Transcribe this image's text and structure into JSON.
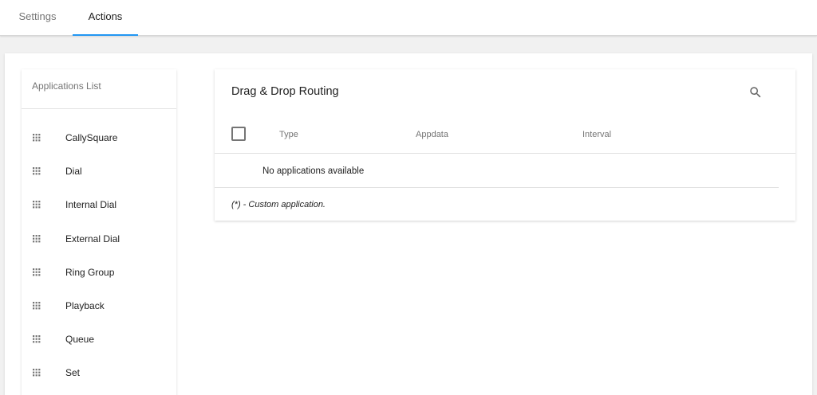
{
  "tabs": {
    "settings": "Settings",
    "actions": "Actions",
    "active": "Actions",
    "accent_color": "#2196f3"
  },
  "applications_list": {
    "title": "Applications List",
    "items": [
      {
        "label": "CallySquare",
        "icon": "drag-handle-icon"
      },
      {
        "label": "Dial",
        "icon": "drag-handle-icon"
      },
      {
        "label": "Internal Dial",
        "icon": "drag-handle-icon"
      },
      {
        "label": "External Dial",
        "icon": "drag-handle-icon"
      },
      {
        "label": "Ring Group",
        "icon": "drag-handle-icon"
      },
      {
        "label": "Playback",
        "icon": "drag-handle-icon"
      },
      {
        "label": "Queue",
        "icon": "drag-handle-icon"
      },
      {
        "label": "Set",
        "icon": "drag-handle-icon"
      }
    ]
  },
  "routing": {
    "title": "Drag & Drop Routing",
    "search_icon": "search-icon",
    "columns": {
      "type": "Type",
      "appdata": "Appdata",
      "interval": "Interval"
    },
    "empty_message": "No applications available",
    "footnote": "(*) - Custom application."
  }
}
